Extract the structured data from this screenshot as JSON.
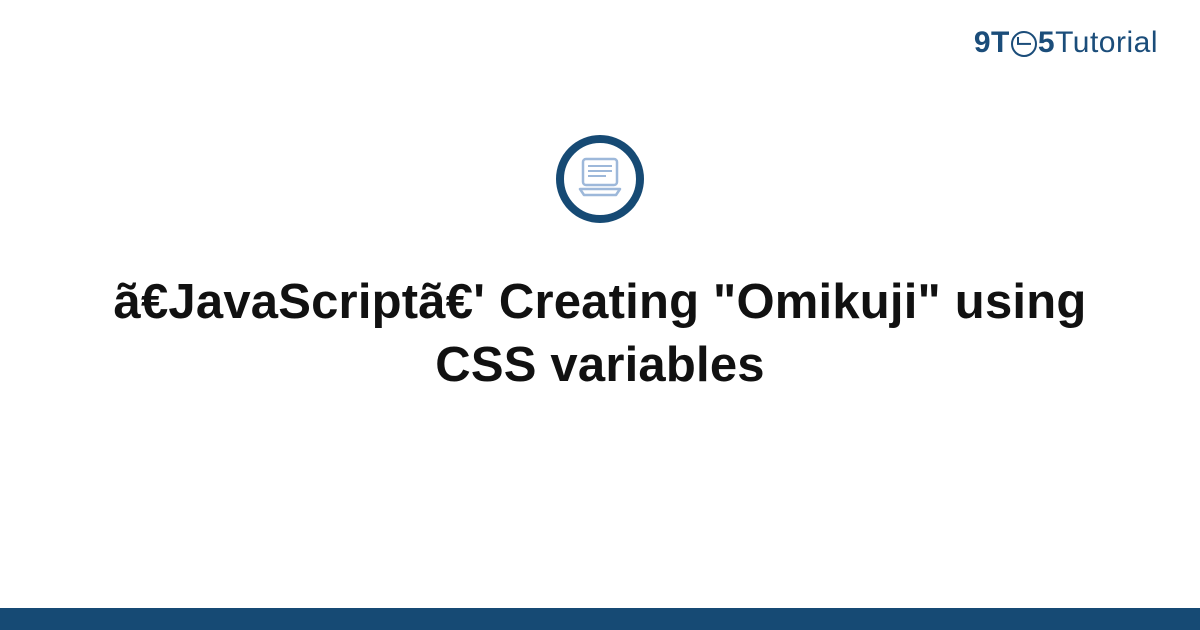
{
  "brand": {
    "part1": "9T",
    "part2": "5",
    "part3": "Tutorial"
  },
  "icon": {
    "name": "laptop-icon"
  },
  "article": {
    "title": "ã€JavaScriptã€' Creating \"Omikuji\" using CSS variables"
  },
  "colors": {
    "brand_navy": "#164a74",
    "text": "#111111",
    "background": "#ffffff",
    "icon_light": "#9db8da"
  }
}
